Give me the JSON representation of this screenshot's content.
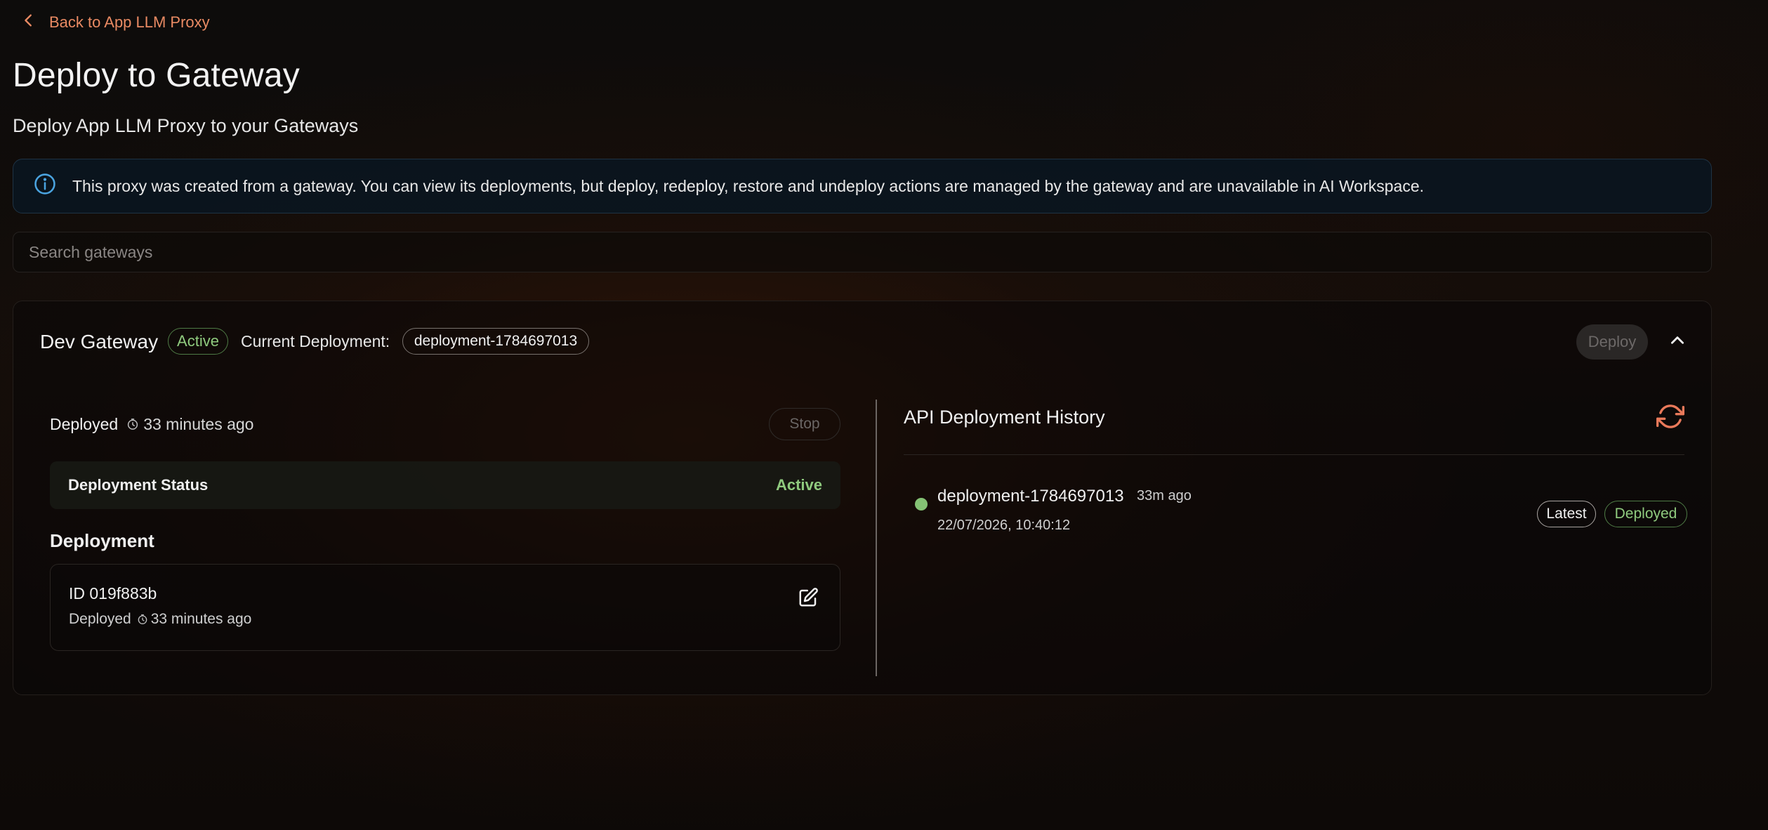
{
  "back_link": {
    "label": "Back to App LLM Proxy"
  },
  "page": {
    "title": "Deploy to Gateway",
    "subtitle": "Deploy App LLM Proxy to your Gateways"
  },
  "info_banner": {
    "icon": "info-circle-icon",
    "text": "This proxy was created from a gateway. You can view its deployments, but deploy, redeploy, restore and undeploy actions are managed by the gateway and are unavailable in AI Workspace."
  },
  "search": {
    "placeholder": "Search gateways",
    "value": ""
  },
  "gateway": {
    "name": "Dev Gateway",
    "status_badge": "Active",
    "current_deployment_label": "Current Deployment:",
    "current_deployment_id": "deployment-1784697013",
    "deploy_label": "Deploy",
    "collapse_icon": "chevron-up-icon",
    "deployed_label": "Deployed",
    "deployed_time": "33 minutes ago",
    "stop_label": "Stop",
    "deployment_status_label": "Deployment Status",
    "deployment_status_value": "Active",
    "deployment_section_title": "Deployment",
    "deployment_item": {
      "id_text": "ID 019f883b",
      "deployed_label": "Deployed",
      "deployed_time": "33 minutes ago",
      "edit_icon": "edit-icon"
    }
  },
  "history": {
    "title": "API Deployment History",
    "refresh_icon": "refresh-icon",
    "items": [
      {
        "name": "deployment-1784697013",
        "ago": "33m ago",
        "date": "22/07/2026, 10:40:12",
        "latest_badge": "Latest",
        "status_badge": "Deployed"
      }
    ]
  },
  "colors": {
    "accent": "#e98a63",
    "success": "#8fca7e",
    "info": "#4aa3df"
  }
}
